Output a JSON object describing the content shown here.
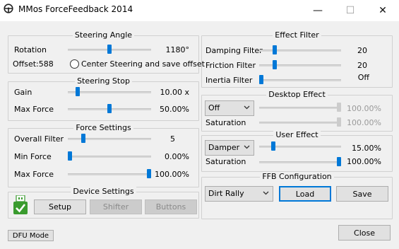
{
  "window": {
    "title": "MMos ForceFeedback 2014",
    "minimize_glyph": "—",
    "maximize_glyph": "☐",
    "close_glyph": "✕"
  },
  "steering_angle": {
    "title": "Steering Angle",
    "rotation_label": "Rotation",
    "rotation_value": "1180°",
    "rotation_level": 0.5,
    "offset_label": "Offset:588",
    "center_label": "Center Steering and save offset"
  },
  "steering_stop": {
    "title": "Steering Stop",
    "gain_label": "Gain",
    "gain_value": "10.00 x",
    "gain_level": 0.1,
    "max_force_label": "Max Force",
    "max_force_value": "50.00%",
    "max_force_level": 0.5
  },
  "force_settings": {
    "title": "Force Settings",
    "overall_filter_label": "Overall Filter",
    "overall_filter_value": "5",
    "overall_filter_level": 0.17,
    "min_force_label": "Min Force",
    "min_force_value": "0.00%",
    "min_force_level": 0.0,
    "max_force_label": "Max Force",
    "max_force_value": "100.00%",
    "max_force_level": 1.0
  },
  "device_settings": {
    "title": "Device Settings",
    "setup_label": "Setup",
    "shifter_label": "Shifter",
    "buttons_label": "Buttons",
    "usb_icon": "usb-check-icon"
  },
  "effect_filter": {
    "title": "Effect Filter",
    "damping_label": "Damping Filter",
    "damping_value": "20",
    "damping_level": 0.17,
    "friction_label": "Friction Filter",
    "friction_value": "20",
    "friction_level": 0.17,
    "inertia_label": "Inertia Filter",
    "inertia_value": "Off",
    "inertia_level": 0.0
  },
  "desktop_effect": {
    "title": "Desktop Effect",
    "selected": "Off",
    "effect_value": "100.00%",
    "effect_level": 1.0,
    "saturation_label": "Saturation",
    "saturation_value": "100.00%"
  },
  "user_effect": {
    "title": "User Effect",
    "selected": "Damper",
    "effect_value": "15.00%",
    "effect_level": 0.15,
    "saturation_label": "Saturation",
    "saturation_value": "100.00%",
    "saturation_level": 1.0
  },
  "ffb_configuration": {
    "title": "FFB Configuration",
    "selected": "Dirt Rally",
    "load_label": "Load",
    "save_label": "Save"
  },
  "footer": {
    "dfu_label": "DFU Mode",
    "close_label": "Close"
  },
  "colors": {
    "accent": "#0078d7",
    "usb_green": "#3a9b2e"
  }
}
